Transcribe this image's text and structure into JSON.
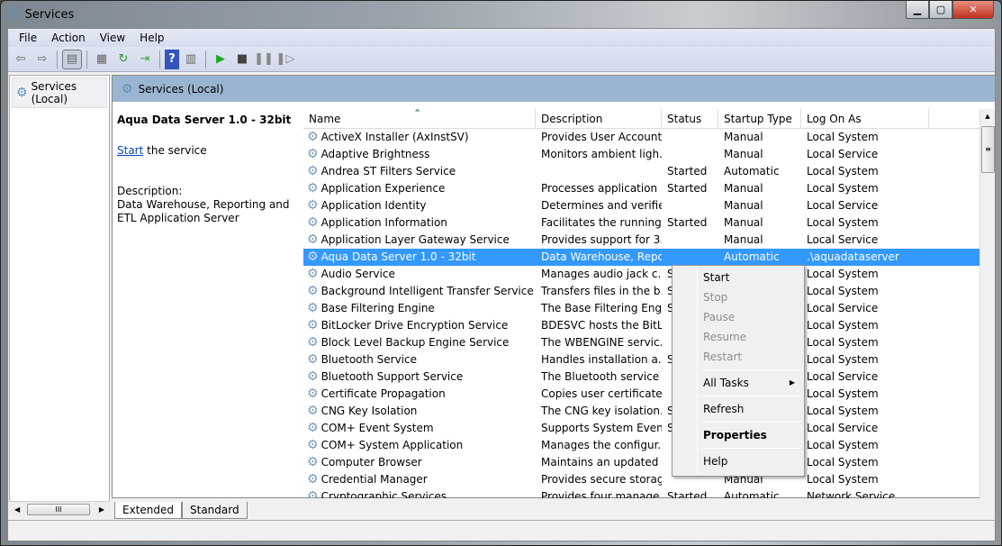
{
  "window": {
    "title": "Services"
  },
  "menubar": [
    "File",
    "Action",
    "View",
    "Help"
  ],
  "toolbar": [
    "back-icon",
    "forward-icon",
    "show-hide-console-tree-icon",
    "properties-icon",
    "refresh-icon",
    "export-list-icon",
    "help-icon",
    "show-action-pane-icon",
    "start-service-icon",
    "stop-service-icon",
    "pause-service-icon",
    "resume-service-icon"
  ],
  "tree": {
    "item": "Services (Local)"
  },
  "header": {
    "title": "Services (Local)"
  },
  "details": {
    "service_title": "Aqua Data Server 1.0 - 32bit",
    "start_link": "Start",
    "start_suffix": " the service",
    "desc_label": "Description:",
    "desc_text": "Data Warehouse, Reporting and ETL Application Server"
  },
  "columns": [
    "Name",
    "Description",
    "Status",
    "Startup Type",
    "Log On As"
  ],
  "rows": [
    [
      "ActiveX Installer (AxInstSV)",
      "Provides User Account...",
      "",
      "Manual",
      "Local System"
    ],
    [
      "Adaptive Brightness",
      "Monitors ambient ligh...",
      "",
      "Manual",
      "Local Service"
    ],
    [
      "Andrea ST Filters Service",
      "",
      "Started",
      "Automatic",
      "Local System"
    ],
    [
      "Application Experience",
      "Processes application ...",
      "Started",
      "Manual",
      "Local System"
    ],
    [
      "Application Identity",
      "Determines and verifie...",
      "",
      "Manual",
      "Local Service"
    ],
    [
      "Application Information",
      "Facilitates the running...",
      "Started",
      "Manual",
      "Local System"
    ],
    [
      "Application Layer Gateway Service",
      "Provides support for 3...",
      "",
      "Manual",
      "Local Service"
    ],
    [
      "Aqua Data Server 1.0 - 32bit",
      "Data Warehouse, Repo...",
      "",
      "Automatic",
      ".\\aquadataserver"
    ],
    [
      "Audio Service",
      "Manages audio jack c...",
      "Started",
      "",
      "Local System"
    ],
    [
      "Background Intelligent Transfer Service",
      "Transfers files in the b...",
      "Started",
      "",
      "Local System"
    ],
    [
      "Base Filtering Engine",
      "The Base Filtering Engi...",
      "Started",
      "",
      "Local Service"
    ],
    [
      "BitLocker Drive Encryption Service",
      "BDESVC hosts the BitL...",
      "",
      "",
      "Local System"
    ],
    [
      "Block Level Backup Engine Service",
      "The WBENGINE servic...",
      "",
      "",
      "Local System"
    ],
    [
      "Bluetooth Service",
      "Handles installation a...",
      "Started",
      "",
      "Local System"
    ],
    [
      "Bluetooth Support Service",
      "The Bluetooth service ...",
      "",
      "",
      "Local Service"
    ],
    [
      "Certificate Propagation",
      "Copies user certificate...",
      "",
      "",
      "Local System"
    ],
    [
      "CNG Key Isolation",
      "The CNG key isolation...",
      "Started",
      "",
      "Local System"
    ],
    [
      "COM+ Event System",
      "Supports System Even...",
      "Started",
      "",
      "Local Service"
    ],
    [
      "COM+ System Application",
      "Manages the configur...",
      "",
      "",
      "Local System"
    ],
    [
      "Computer Browser",
      "Maintains an updated ...",
      "",
      "",
      "Local System"
    ],
    [
      "Credential Manager",
      "Provides secure storag...",
      "",
      "Manual",
      "Local System"
    ],
    [
      "Cryptographic Services",
      "Provides four manage...",
      "Started",
      "Automatic",
      "Network Service"
    ]
  ],
  "selected_row": 7,
  "tabs": [
    "Extended",
    "Standard"
  ],
  "context_menu": {
    "items": [
      {
        "label": "Start",
        "enabled": true
      },
      {
        "label": "Stop",
        "enabled": false
      },
      {
        "label": "Pause",
        "enabled": false
      },
      {
        "label": "Resume",
        "enabled": false
      },
      {
        "label": "Restart",
        "enabled": false
      },
      {
        "sep": true
      },
      {
        "label": "All Tasks",
        "enabled": true,
        "submenu": true
      },
      {
        "sep": true
      },
      {
        "label": "Refresh",
        "enabled": true
      },
      {
        "sep": true
      },
      {
        "label": "Properties",
        "enabled": true,
        "bold": true
      },
      {
        "sep": true
      },
      {
        "label": "Help",
        "enabled": true
      }
    ]
  },
  "colors": {
    "selection": "#3399ff",
    "header_band": "#9ab5d1",
    "link": "#0645ad"
  }
}
